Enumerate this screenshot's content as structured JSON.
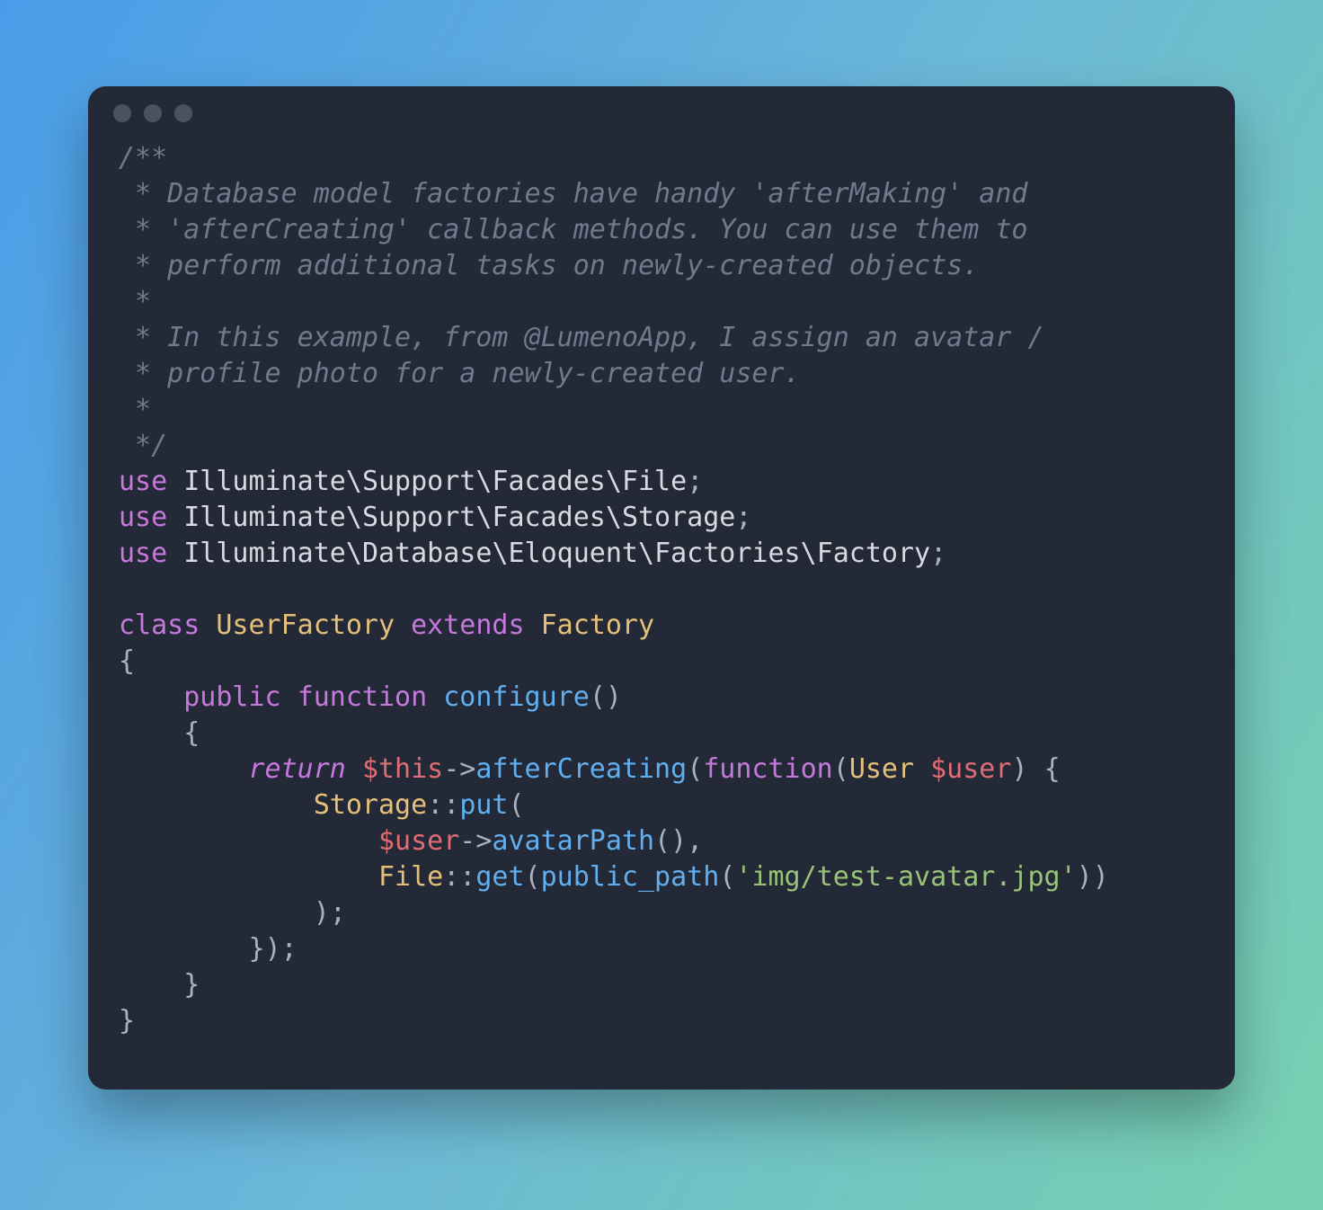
{
  "comment": {
    "l1": "/**",
    "l2": " * Database model factories have handy 'afterMaking' and",
    "l3": " * 'afterCreating' callback methods. You can use them to",
    "l4": " * perform additional tasks on newly-created objects.",
    "l5": " *",
    "l6": " * In this example, from @LumenoApp, I assign an avatar /",
    "l7": " * profile photo for a newly-created user.",
    "l8": " *",
    "l9": " */"
  },
  "kw": {
    "use": "use",
    "class": "class",
    "extends": "extends",
    "public": "public",
    "function": "function",
    "return": "return"
  },
  "imports": {
    "ns1_a": "Illuminate",
    "ns1_b": "Support",
    "ns1_c": "Facades",
    "ns1_d": "File",
    "ns2_a": "Illuminate",
    "ns2_b": "Support",
    "ns2_c": "Facades",
    "ns2_d": "Storage",
    "ns3_a": "Illuminate",
    "ns3_b": "Database",
    "ns3_c": "Eloquent",
    "ns3_d": "Factories",
    "ns3_e": "Factory"
  },
  "cls": {
    "UserFactory": "UserFactory",
    "Factory": "Factory",
    "Storage": "Storage",
    "File": "File",
    "User": "User"
  },
  "fn": {
    "configure": "configure",
    "afterCreating": "afterCreating",
    "put": "put",
    "avatarPath": "avatarPath",
    "get": "get",
    "public_path": "public_path"
  },
  "vars": {
    "this": "$this",
    "user": "$user"
  },
  "str": {
    "avatar": "'img/test-avatar.jpg'"
  },
  "p": {
    "bs": "\\",
    "semi": ";",
    "arrow": "->",
    "dcolon": "::",
    "lp": "(",
    "rp": ")",
    "lb": "{",
    "rb": "}",
    "comma": ",",
    "sp": " "
  }
}
